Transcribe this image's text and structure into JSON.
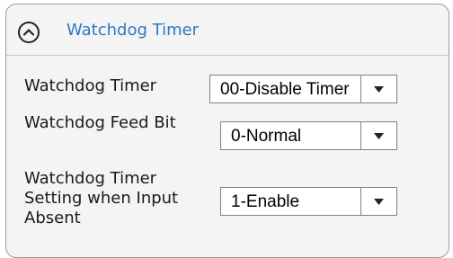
{
  "panel": {
    "title": "Watchdog Timer",
    "collapse_icon": "chevron-up-circle-icon"
  },
  "fields": [
    {
      "label": "Watchdog Timer",
      "value": "00-Disable Timer"
    },
    {
      "label": "Watchdog Feed Bit",
      "value": "0-Normal"
    },
    {
      "label": "Watchdog Timer Setting when Input Absent",
      "value": "1-Enable"
    }
  ],
  "colors": {
    "title": "#2f78c4",
    "panel_bg": "#f4f4f4",
    "border": "#9a9a9a"
  },
  "dropdown_icon": "caret-down-icon"
}
